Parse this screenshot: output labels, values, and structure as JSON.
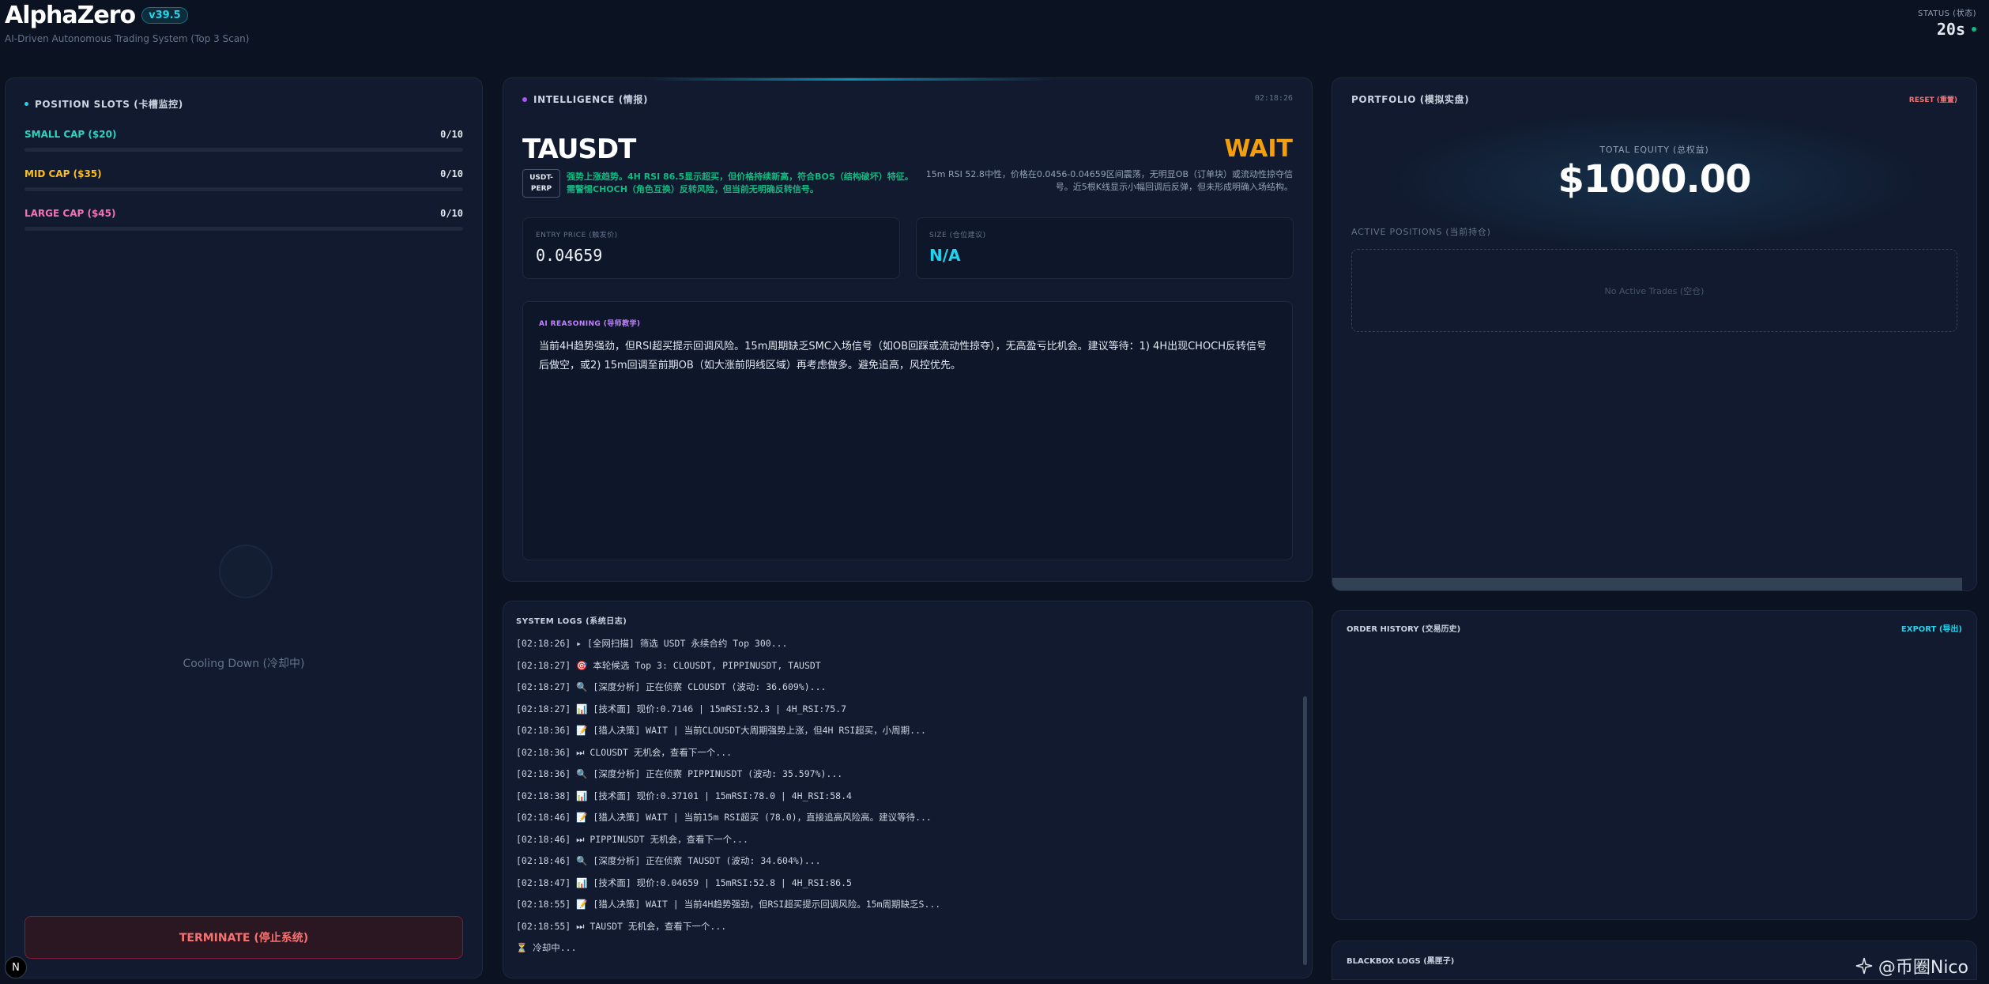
{
  "header": {
    "title": "AlphaZero",
    "version": "v39.5",
    "subtitle": "AI-Driven Autonomous Trading System (Top 3 Scan)",
    "status_label": "STATUS (状态)",
    "status_value": "20s"
  },
  "slots": {
    "title": "POSITION SLOTS (卡槽监控)",
    "items": [
      {
        "label": "SMALL CAP ($20)",
        "count": "0/10",
        "color": "#2dd4bf"
      },
      {
        "label": "MID CAP ($35)",
        "count": "0/10",
        "color": "#fbbf24"
      },
      {
        "label": "LARGE CAP ($45)",
        "count": "0/10",
        "color": "#f472b6"
      }
    ],
    "cooldown": "Cooling Down (冷却中)",
    "terminate": "TERMINATE (停止系统)"
  },
  "intel": {
    "title": "INTELLIGENCE (情报)",
    "time": "02:18:26",
    "symbol": "TAUSDT",
    "signal": "WAIT",
    "badge": "USDT-PERP",
    "trend": "强势上涨趋势。4H RSI 86.5显示超买，但价格持续新高，符合BOS（结构破坏）特征。需警惕CHOCH（角色互换）反转风险，但当前无明确反转信号。",
    "detail": "15m RSI 52.8中性，价格在0.0456-0.04659区间震荡，无明显OB（订单块）或流动性掠夺信号。近5根K线显示小幅回调后反弹，但未形成明确入场结构。",
    "entry_label": "ENTRY PRICE (触发价)",
    "entry_value": "0.04659",
    "size_label": "SIZE (仓位建议)",
    "size_value": "N/A",
    "reason_label": "AI REASONING (导师教学)",
    "reason_text": "当前4H趋势强劲，但RSI超买提示回调风险。15m周期缺乏SMC入场信号（如OB回踩或流动性掠夺），无高盈亏比机会。建议等待：1) 4H出现CHOCH反转信号后做空，或2) 15m回调至前期OB（如大涨前阴线区域）再考虑做多。避免追高，风控优先。"
  },
  "logs": {
    "title": "SYSTEM LOGS (系统日志)",
    "lines": [
      {
        "icon": "📡",
        "text": "[02:18:26] ▸ [全网扫描] 筛选 USDT 永续合约 Top 300..."
      },
      {
        "icon": "🎯",
        "text": "[02:18:27] 🎯 本轮候选 Top 3: CLOUSDT, PIPPINUSDT, TAUSDT"
      },
      {
        "icon": "🔍",
        "text": "[02:18:27] 🔍 [深度分析] 正在侦察 CLOUSDT (波动: 36.609%)..."
      },
      {
        "icon": "📊",
        "text": "[02:18:27] 📊 [技术面] 现价:0.7146 | 15mRSI:52.3 | 4H_RSI:75.7"
      },
      {
        "icon": "📝",
        "text": "[02:18:36] 📝 [猎人决策] WAIT | 当前CLOUSDT大周期强势上涨，但4H RSI超买，小周期..."
      },
      {
        "icon": "⏭",
        "text": "[02:18:36] ⏭ CLOUSDT 无机会，查看下一个..."
      },
      {
        "icon": "🔍",
        "text": "[02:18:36] 🔍 [深度分析] 正在侦察 PIPPINUSDT (波动: 35.597%)..."
      },
      {
        "icon": "📊",
        "text": "[02:18:38] 📊 [技术面] 现价:0.37101 | 15mRSI:78.0 | 4H_RSI:58.4"
      },
      {
        "icon": "📝",
        "text": "[02:18:46] 📝 [猎人决策] WAIT | 当前15m RSI超买 (78.0)，直接追高风险高。建议等待..."
      },
      {
        "icon": "⏭",
        "text": "[02:18:46] ⏭ PIPPINUSDT 无机会，查看下一个..."
      },
      {
        "icon": "🔍",
        "text": "[02:18:46] 🔍 [深度分析] 正在侦察 TAUSDT (波动: 34.604%)..."
      },
      {
        "icon": "📊",
        "text": "[02:18:47] 📊 [技术面] 现价:0.04659 | 15mRSI:52.8 | 4H_RSI:86.5"
      },
      {
        "icon": "📝",
        "text": "[02:18:55] 📝 [猎人决策] WAIT | 当前4H趋势强劲，但RSI超买提示回调风险。15m周期缺乏S..."
      },
      {
        "icon": "⏭",
        "text": "[02:18:55] ⏭ TAUSDT 无机会，查看下一个..."
      },
      {
        "icon": "⏳",
        "text": "⏳ 冷却中..."
      }
    ]
  },
  "portfolio": {
    "title": "PORTFOLIO (模拟实盘)",
    "reset": "RESET (重置)",
    "equity_label": "TOTAL EQUITY (总权益)",
    "equity_value": "$1000.00",
    "active_label": "ACTIVE POSITIONS (当前持仓)",
    "no_trades": "No Active Trades (空仓)"
  },
  "orders": {
    "title": "ORDER HISTORY (交易历史)",
    "export": "EXPORT (导出)"
  },
  "blackbox": {
    "title": "BLACKBOX LOGS (黑匣子)"
  },
  "floating": {
    "n_label": "N",
    "watermark": "@币圈Nico"
  }
}
